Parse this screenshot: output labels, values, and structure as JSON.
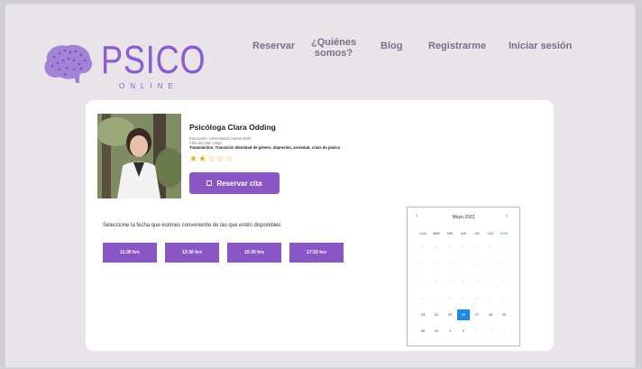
{
  "brand": {
    "name": "PSICO",
    "subtitle": "ONLINE",
    "accent": "#8a56c6"
  },
  "nav": {
    "reservar": "Reservar",
    "quienes_1": "¿Quiénes",
    "quienes_2": "somos?",
    "blog": "Blog",
    "registrarme": "Registrarme",
    "login": "Iniciar sesión"
  },
  "profile": {
    "name": "Psicóloga Clara Odding",
    "line1": "Educación: Universidad Andrés Bello",
    "line2": "Viña del Mar • Stgo",
    "line3": "Tratamientos: Transición Identidad de género, depresión, ansiedad, crisis de pánico",
    "rating": 2,
    "rating_max": 5,
    "book_label": "Reservar cita"
  },
  "schedule": {
    "prompt": "Seleccione la fecha que estimes conveniente de las que estén disponibles",
    "slots": [
      "11:30 hrs",
      "12:30 hrs",
      "15:30 hrs",
      "17:15 hrs"
    ]
  },
  "calendar": {
    "month": "Mayo 2022",
    "prev": "‹",
    "next": "›",
    "weekdays": [
      "LUN",
      "MAR",
      "MIE",
      "JUE",
      "VIE",
      "SAB",
      "DOM"
    ],
    "weeks": [
      [
        "25",
        "26",
        "27",
        "28",
        "29",
        "30",
        "1"
      ],
      [
        "2",
        "3",
        "4",
        "5",
        "6",
        "7",
        "8"
      ],
      [
        "9",
        "10",
        "11",
        "12",
        "13",
        "14",
        "15"
      ],
      [
        "16",
        "17",
        "18",
        "19",
        "20",
        "21",
        "22"
      ],
      [
        "23",
        "24",
        "25",
        "26",
        "27",
        "28",
        "29"
      ],
      [
        "30",
        "31",
        "1",
        "2",
        "3",
        "4",
        "5"
      ]
    ],
    "selected": "26"
  }
}
